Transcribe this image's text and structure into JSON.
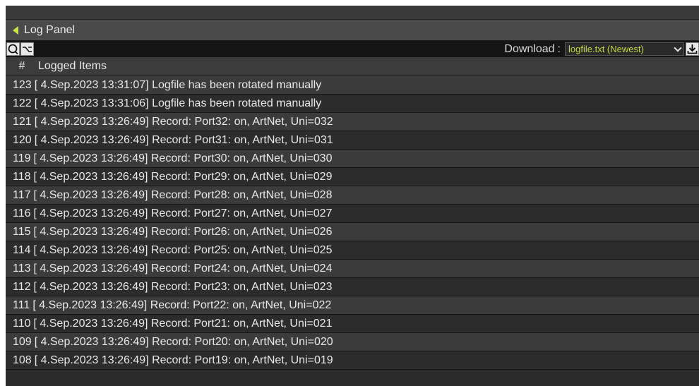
{
  "panel": {
    "title": "Log Panel"
  },
  "toolbar": {
    "refresh_icon": "search-icon",
    "filter_icon": "filter-icon",
    "download_label": "Download",
    "download_sep": ":",
    "download_value": "logfile.txt (Newest)",
    "download_icon": "download-icon"
  },
  "table": {
    "headers": [
      "#",
      "Logged Items"
    ],
    "rows": [
      {
        "n": "123",
        "text": "[ 4.Sep.2023 13:31:07] Logfile has been rotated manually"
      },
      {
        "n": "122",
        "text": "[ 4.Sep.2023 13:31:06] Logfile has been rotated manually"
      },
      {
        "n": "121",
        "text": "[ 4.Sep.2023 13:26:49] Record: Port32: on, ArtNet, Uni=032"
      },
      {
        "n": "120",
        "text": "[ 4.Sep.2023 13:26:49] Record: Port31: on, ArtNet, Uni=031"
      },
      {
        "n": "119",
        "text": "[ 4.Sep.2023 13:26:49] Record: Port30: on, ArtNet, Uni=030"
      },
      {
        "n": "118",
        "text": "[ 4.Sep.2023 13:26:49] Record: Port29: on, ArtNet, Uni=029"
      },
      {
        "n": "117",
        "text": "[ 4.Sep.2023 13:26:49] Record: Port28: on, ArtNet, Uni=028"
      },
      {
        "n": "116",
        "text": "[ 4.Sep.2023 13:26:49] Record: Port27: on, ArtNet, Uni=027"
      },
      {
        "n": "115",
        "text": "[ 4.Sep.2023 13:26:49] Record: Port26: on, ArtNet, Uni=026"
      },
      {
        "n": "114",
        "text": "[ 4.Sep.2023 13:26:49] Record: Port25: on, ArtNet, Uni=025"
      },
      {
        "n": "113",
        "text": "[ 4.Sep.2023 13:26:49] Record: Port24: on, ArtNet, Uni=024"
      },
      {
        "n": "112",
        "text": "[ 4.Sep.2023 13:26:49] Record: Port23: on, ArtNet, Uni=023"
      },
      {
        "n": "111",
        "text": "[ 4.Sep.2023 13:26:49] Record: Port22: on, ArtNet, Uni=022"
      },
      {
        "n": "110",
        "text": "[ 4.Sep.2023 13:26:49] Record: Port21: on, ArtNet, Uni=021"
      },
      {
        "n": "109",
        "text": "[ 4.Sep.2023 13:26:49] Record: Port20: on, ArtNet, Uni=020"
      },
      {
        "n": "108",
        "text": "[ 4.Sep.2023 13:26:49] Record: Port19: on, ArtNet, Uni=019"
      }
    ]
  },
  "colors": {
    "accent": "#cde14a",
    "select_text": "#c6d83a"
  }
}
